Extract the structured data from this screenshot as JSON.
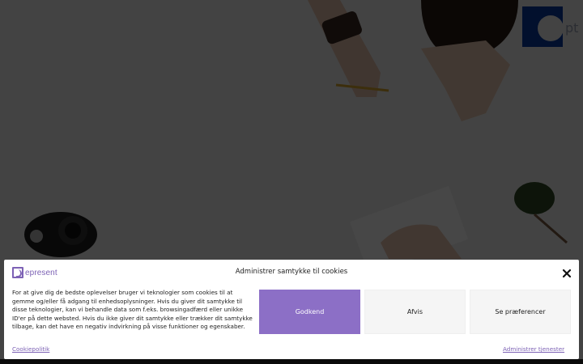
{
  "colors": {
    "accent": "#8c6fc6",
    "link": "#7d62b5",
    "overlay": "rgba(0,0,0,0.72)"
  },
  "background": {
    "brand_partial_text": "pt"
  },
  "cookie_banner": {
    "logo_text": "epresent",
    "title": "Administrer samtykke til cookies",
    "body": "For at give dig de bedste oplevelser bruger vi teknologier som cookies til at gemme og/eller få adgang til enhedsoplysninger. Hvis du giver dit samtykke til disse teknologier, kan vi behandle data som f.eks. browsingadfærd eller unikke ID'er på dette websted. Hvis du ikke giver dit samtykke eller trækker dit samtykke tilbage, kan det have en negativ indvirkning på visse funktioner og egenskaber.",
    "buttons": {
      "accept": "Godkend",
      "deny": "Afvis",
      "preferences": "Se præferencer"
    },
    "links": {
      "policy": "Cookiepolitik",
      "manage": "Administrer tjenester"
    },
    "icons": {
      "close": "close-icon",
      "logo": "logo-mark-icon"
    }
  }
}
